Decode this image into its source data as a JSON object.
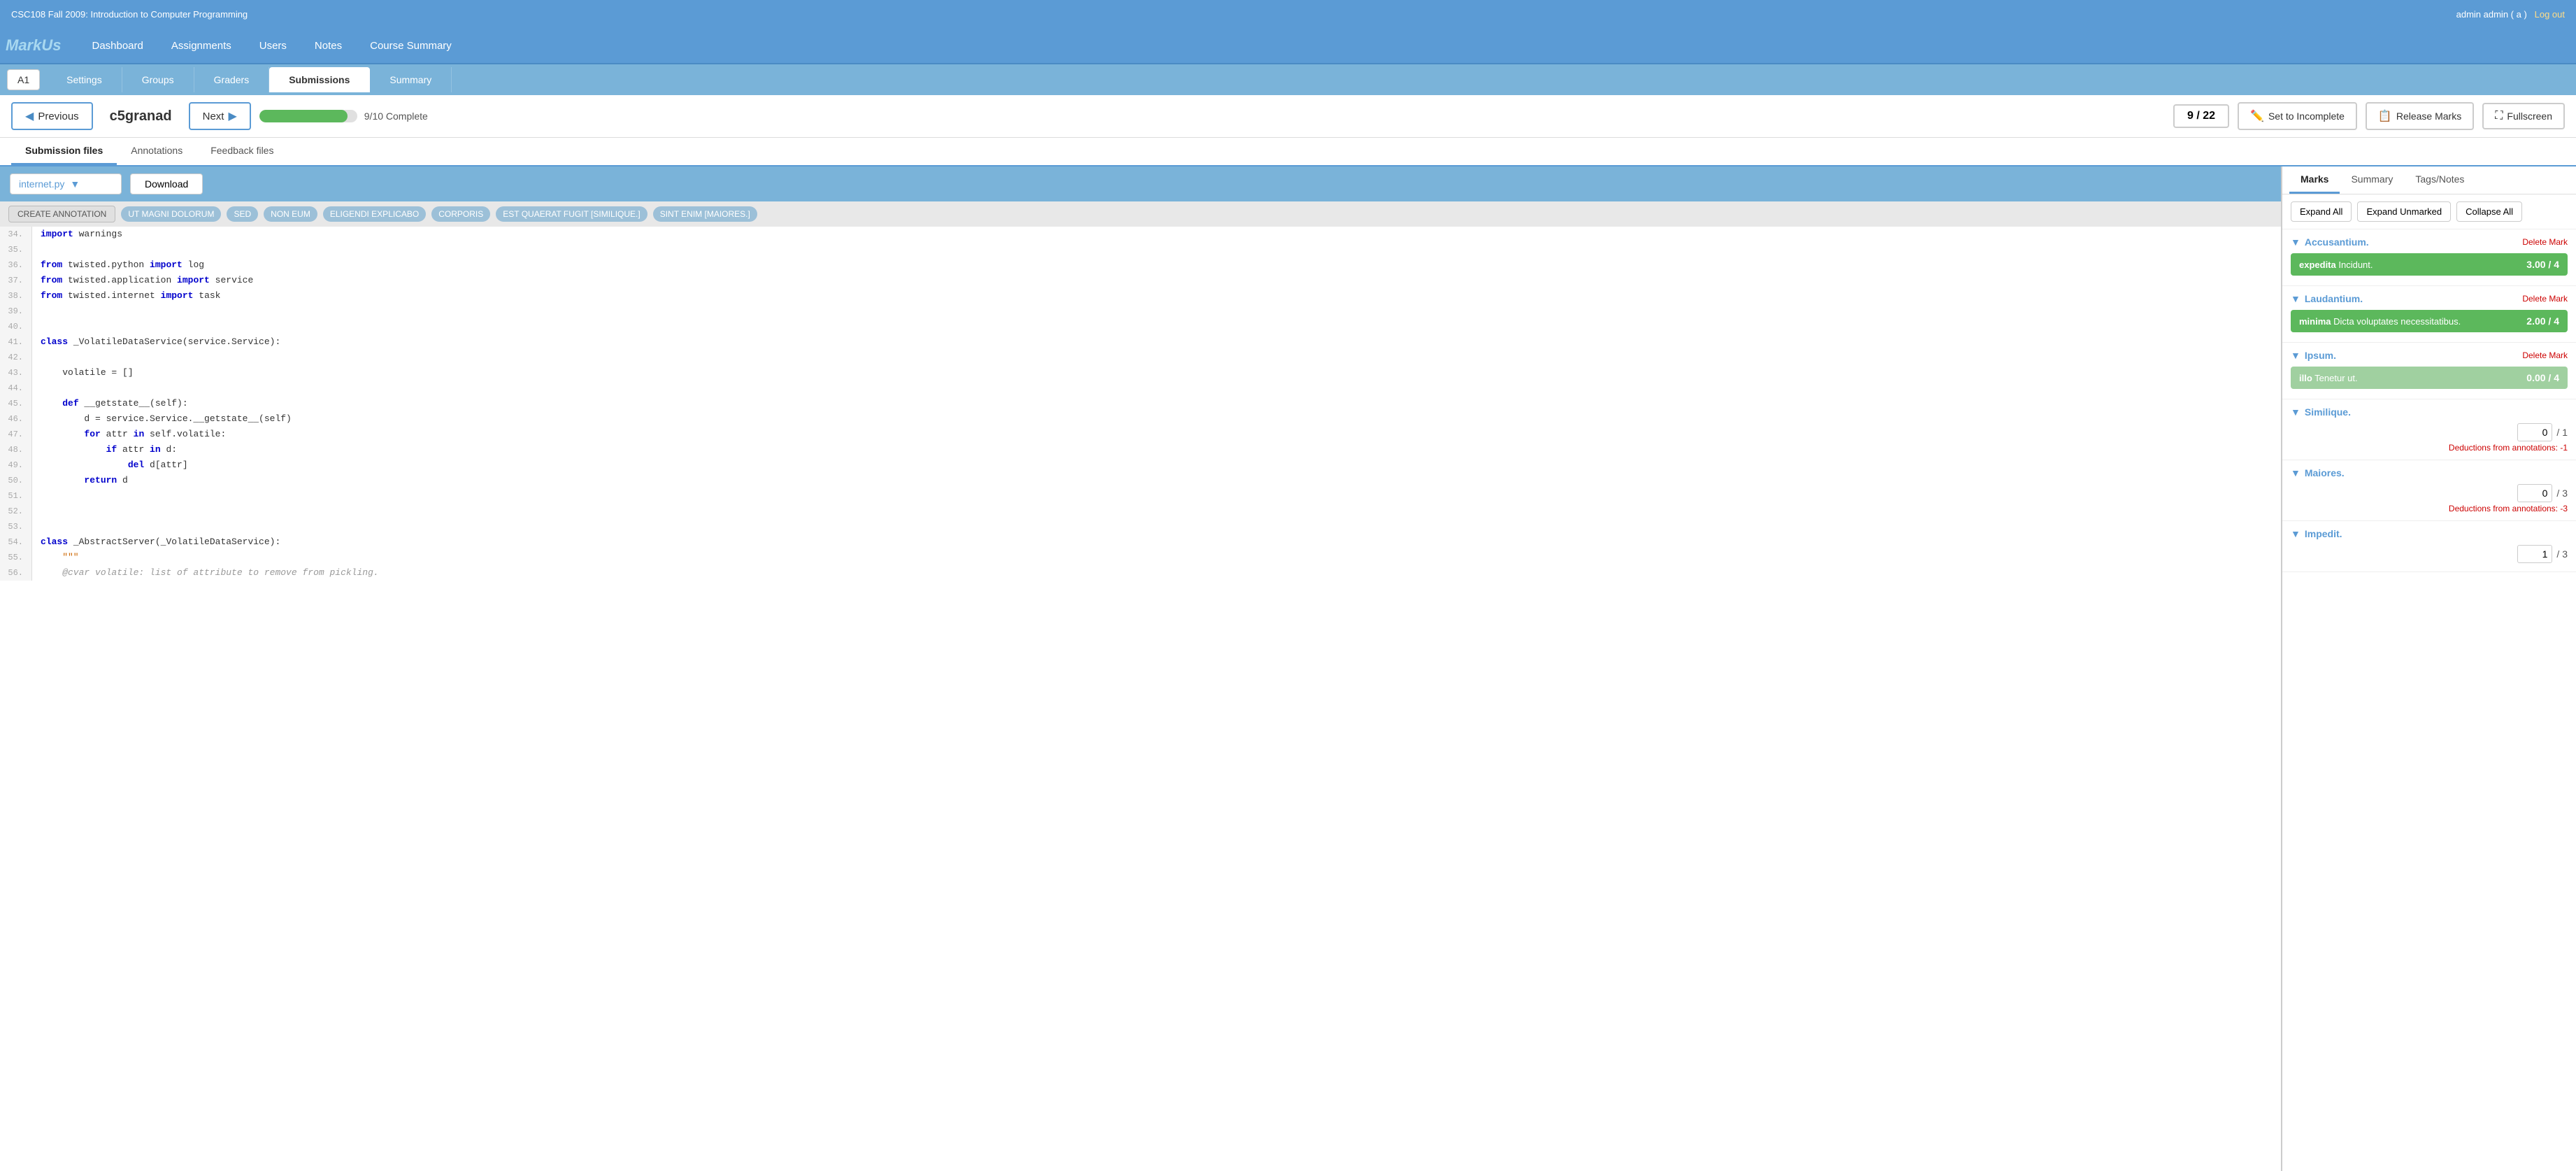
{
  "topBar": {
    "courseTitle": "CSC108 Fall 2009: Introduction to Computer Programming",
    "userInfo": "admin admin ( a )",
    "logoutLabel": "Log out"
  },
  "nav": {
    "logoText": "MarkUs",
    "links": [
      "Dashboard",
      "Assignments",
      "Users",
      "Notes",
      "Course Summary"
    ]
  },
  "subNav": {
    "assignmentLabel": "A1",
    "tabs": [
      "Settings",
      "Groups",
      "Graders",
      "Submissions",
      "Summary"
    ],
    "activeTab": "Submissions"
  },
  "toolbar": {
    "prevLabel": "Previous",
    "nextLabel": "Next",
    "studentName": "c5granad",
    "progressValue": "9/10 Complete",
    "progressPercent": 90,
    "pageCounter": "9 / 22",
    "setIncompleteLabel": "Set to Incomplete",
    "releaseMarksLabel": "Release Marks",
    "fullscreenLabel": "Fullscreen"
  },
  "contentTabs": {
    "tabs": [
      "Submission files",
      "Annotations",
      "Feedback files"
    ],
    "activeTab": "Submission files"
  },
  "fileToolbar": {
    "filename": "internet.py",
    "downloadLabel": "Download"
  },
  "annotations": {
    "createLabel": "CREATE ANNOTATION",
    "tags": [
      "UT MAGNI DOLORUM",
      "SED",
      "NON EUM",
      "ELIGENDI EXPLICABO",
      "CORPORIS",
      "EST QUAERAT FUGIT [SIMILIQUE.]",
      "SINT ENIM [MAIORES.]"
    ]
  },
  "code": {
    "lines": [
      {
        "num": "34.",
        "content": "import warnings",
        "tokens": [
          {
            "t": "kw",
            "v": "import"
          },
          {
            "t": "plain",
            "v": " warnings"
          }
        ]
      },
      {
        "num": "35.",
        "content": "",
        "tokens": []
      },
      {
        "num": "36.",
        "content": "from twisted.python import log",
        "tokens": [
          {
            "t": "kw",
            "v": "from"
          },
          {
            "t": "plain",
            "v": " twisted.python "
          },
          {
            "t": "kw",
            "v": "import"
          },
          {
            "t": "plain",
            "v": " log"
          }
        ]
      },
      {
        "num": "37.",
        "content": "from twisted.application import service",
        "tokens": [
          {
            "t": "kw",
            "v": "from"
          },
          {
            "t": "plain",
            "v": " twisted.application "
          },
          {
            "t": "kw",
            "v": "import"
          },
          {
            "t": "plain",
            "v": " service"
          }
        ]
      },
      {
        "num": "38.",
        "content": "from twisted.internet import task",
        "tokens": [
          {
            "t": "kw",
            "v": "from"
          },
          {
            "t": "plain",
            "v": " twisted.internet "
          },
          {
            "t": "kw",
            "v": "import"
          },
          {
            "t": "plain",
            "v": " task"
          }
        ]
      },
      {
        "num": "39.",
        "content": "",
        "tokens": []
      },
      {
        "num": "40.",
        "content": "",
        "tokens": []
      },
      {
        "num": "41.",
        "content": "class _VolatileDataService(service.Service):",
        "tokens": [
          {
            "t": "kw",
            "v": "class"
          },
          {
            "t": "plain",
            "v": " _VolatileDataService(service.Service):"
          }
        ]
      },
      {
        "num": "42.",
        "content": "",
        "tokens": []
      },
      {
        "num": "43.",
        "content": "    volatile = []",
        "tokens": [
          {
            "t": "plain",
            "v": "    volatile = []"
          }
        ]
      },
      {
        "num": "44.",
        "content": "",
        "tokens": []
      },
      {
        "num": "45.",
        "content": "    def __getstate__(self):",
        "tokens": [
          {
            "t": "plain",
            "v": "    "
          },
          {
            "t": "kw",
            "v": "def"
          },
          {
            "t": "plain",
            "v": " __getstate__(self):"
          }
        ]
      },
      {
        "num": "46.",
        "content": "        d = service.Service.__getstate__(self)",
        "tokens": [
          {
            "t": "plain",
            "v": "        d = service.Service.__getstate__(self)"
          }
        ]
      },
      {
        "num": "47.",
        "content": "        for attr in self.volatile:",
        "tokens": [
          {
            "t": "plain",
            "v": "        "
          },
          {
            "t": "kw",
            "v": "for"
          },
          {
            "t": "plain",
            "v": " attr "
          },
          {
            "t": "kw",
            "v": "in"
          },
          {
            "t": "plain",
            "v": " self.volatile:"
          }
        ]
      },
      {
        "num": "48.",
        "content": "            if attr in d:",
        "tokens": [
          {
            "t": "plain",
            "v": "            "
          },
          {
            "t": "kw",
            "v": "if"
          },
          {
            "t": "plain",
            "v": " attr "
          },
          {
            "t": "kw",
            "v": "in"
          },
          {
            "t": "plain",
            "v": " d:"
          }
        ]
      },
      {
        "num": "49.",
        "content": "                del d[attr]",
        "tokens": [
          {
            "t": "plain",
            "v": "                "
          },
          {
            "t": "kw",
            "v": "del"
          },
          {
            "t": "plain",
            "v": " d[attr]"
          }
        ]
      },
      {
        "num": "50.",
        "content": "        return d",
        "tokens": [
          {
            "t": "plain",
            "v": "        "
          },
          {
            "t": "kw",
            "v": "return"
          },
          {
            "t": "plain",
            "v": " d"
          }
        ]
      },
      {
        "num": "51.",
        "content": "",
        "tokens": []
      },
      {
        "num": "52.",
        "content": "",
        "tokens": []
      },
      {
        "num": "53.",
        "content": "",
        "tokens": []
      },
      {
        "num": "54.",
        "content": "class _AbstractServer(_VolatileDataService):",
        "tokens": [
          {
            "t": "kw",
            "v": "class"
          },
          {
            "t": "plain",
            "v": " _AbstractServer(_VolatileDataService):"
          }
        ]
      },
      {
        "num": "55.",
        "content": "    \"\"\"",
        "tokens": [
          {
            "t": "str",
            "v": "    \"\"\""
          }
        ]
      },
      {
        "num": "56.",
        "content": "    @cvar volatile: list of attribute to remove from pickling.",
        "tokens": [
          {
            "t": "cm",
            "v": "    @cvar volatile: list of attribute to remove from pickling."
          }
        ]
      }
    ]
  },
  "rightPanel": {
    "tabs": [
      "Marks",
      "Summary",
      "Tags/Notes"
    ],
    "activeTab": "Marks",
    "controls": {
      "expandAll": "Expand All",
      "expandUnmarked": "Expand Unmarked",
      "collapseAll": "Collapse All"
    },
    "sections": [
      {
        "title": "Accusantium.",
        "items": [
          {
            "bold": "expedita",
            "text": " Incidunt.",
            "score": "3.00 / 4",
            "color": "green"
          }
        ],
        "hasInput": false
      },
      {
        "title": "Laudantium.",
        "items": [
          {
            "bold": "minima",
            "text": " Dicta voluptates necessitatibus.",
            "score": "2.00 / 4",
            "color": "green"
          }
        ],
        "hasInput": false
      },
      {
        "title": "Ipsum.",
        "items": [
          {
            "bold": "illo",
            "text": " Tenetur ut.",
            "score": "0.00 / 4",
            "color": "light-green"
          }
        ],
        "hasInput": false
      },
      {
        "title": "Similique.",
        "items": [],
        "hasInput": true,
        "inputValue": "0",
        "total": "/ 1",
        "deductions": "Deductions from annotations: -1"
      },
      {
        "title": "Maiores.",
        "items": [],
        "hasInput": true,
        "inputValue": "0",
        "total": "/ 3",
        "deductions": "Deductions from annotations: -3"
      },
      {
        "title": "Impedit.",
        "items": [],
        "hasInput": true,
        "inputValue": "1",
        "total": "/ 3",
        "deductions": ""
      }
    ]
  },
  "colors": {
    "accent": "#5b9bd5",
    "green": "#5cb85c",
    "navBg": "#5b9bd5",
    "subNavBg": "#7ab3d9"
  }
}
